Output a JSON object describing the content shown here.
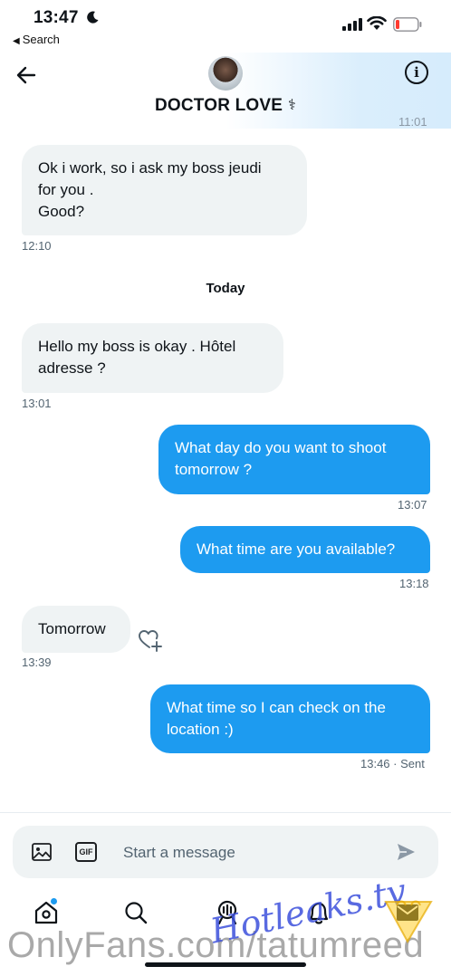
{
  "status_bar": {
    "time": "13:47",
    "back_label": "Search"
  },
  "header": {
    "contact_name": "DOCTOR LOVE",
    "name_emoji": "⚕",
    "clipped_timestamp": "11:01"
  },
  "messages": [
    {
      "direction": "incoming",
      "lines": [
        "Ok  i work, so i ask my boss jeudi",
        "for you .",
        "Good?"
      ],
      "time": "12:10"
    },
    {
      "direction": "incoming",
      "lines": [
        "Hello  my boss is okay  . Hôtel",
        "adresse ?"
      ],
      "time": "13:01"
    },
    {
      "direction": "outgoing",
      "lines": [
        "What day do you want to shoot",
        "tomorrow ?"
      ],
      "time": "13:07"
    },
    {
      "direction": "outgoing",
      "lines": [
        "What time are you available?"
      ],
      "time": "13:18"
    },
    {
      "direction": "incoming",
      "lines": [
        "Tomorrow"
      ],
      "time": "13:39"
    },
    {
      "direction": "outgoing",
      "lines": [
        "What time so I can check on the",
        "location :)"
      ],
      "time": "13:46 · Sent"
    }
  ],
  "day_divider": "Today",
  "composer": {
    "placeholder": "Start a message",
    "gif_label": "GIF"
  },
  "tabs": [
    "home",
    "search",
    "spaces",
    "notifications",
    "messages"
  ],
  "overlay": {
    "watermark": "OnlyFans.com/tatumreed",
    "signature": "Hotleaks.tv"
  },
  "colors": {
    "accent": "#1d9bf0",
    "incoming_bubble": "#eff3f4",
    "text_primary": "#0f1419",
    "text_secondary": "#536471"
  }
}
